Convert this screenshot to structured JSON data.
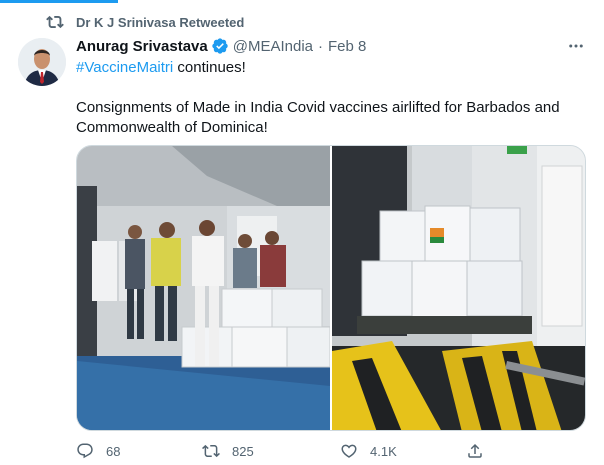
{
  "retweet_banner": {
    "text": "Dr K J Srinivasa Retweeted",
    "icon": "retweet-icon"
  },
  "tweet": {
    "author_name": "Anurag Srivastava",
    "verified_icon": "verified-badge-icon",
    "handle": "@MEAIndia",
    "separator": "·",
    "date": "Feb 8",
    "hashtag": "#VaccineMaitri",
    "line1_rest": " continues!",
    "body": "Consignments of Made in India Covid vaccines airlifted for Barbados and Commonwealth of Dominica!",
    "images": [
      {
        "icon": "photo-officials-with-vaccine-boxes"
      },
      {
        "icon": "photo-vaccine-pallet-on-loader"
      }
    ]
  },
  "actions": {
    "reply_count": "68",
    "retweet_count": "825",
    "like_count": "4.1K"
  },
  "colors": {
    "accent": "#1d9bf0",
    "muted": "#536471",
    "text": "#0f1419",
    "border": "#cfd9de"
  }
}
